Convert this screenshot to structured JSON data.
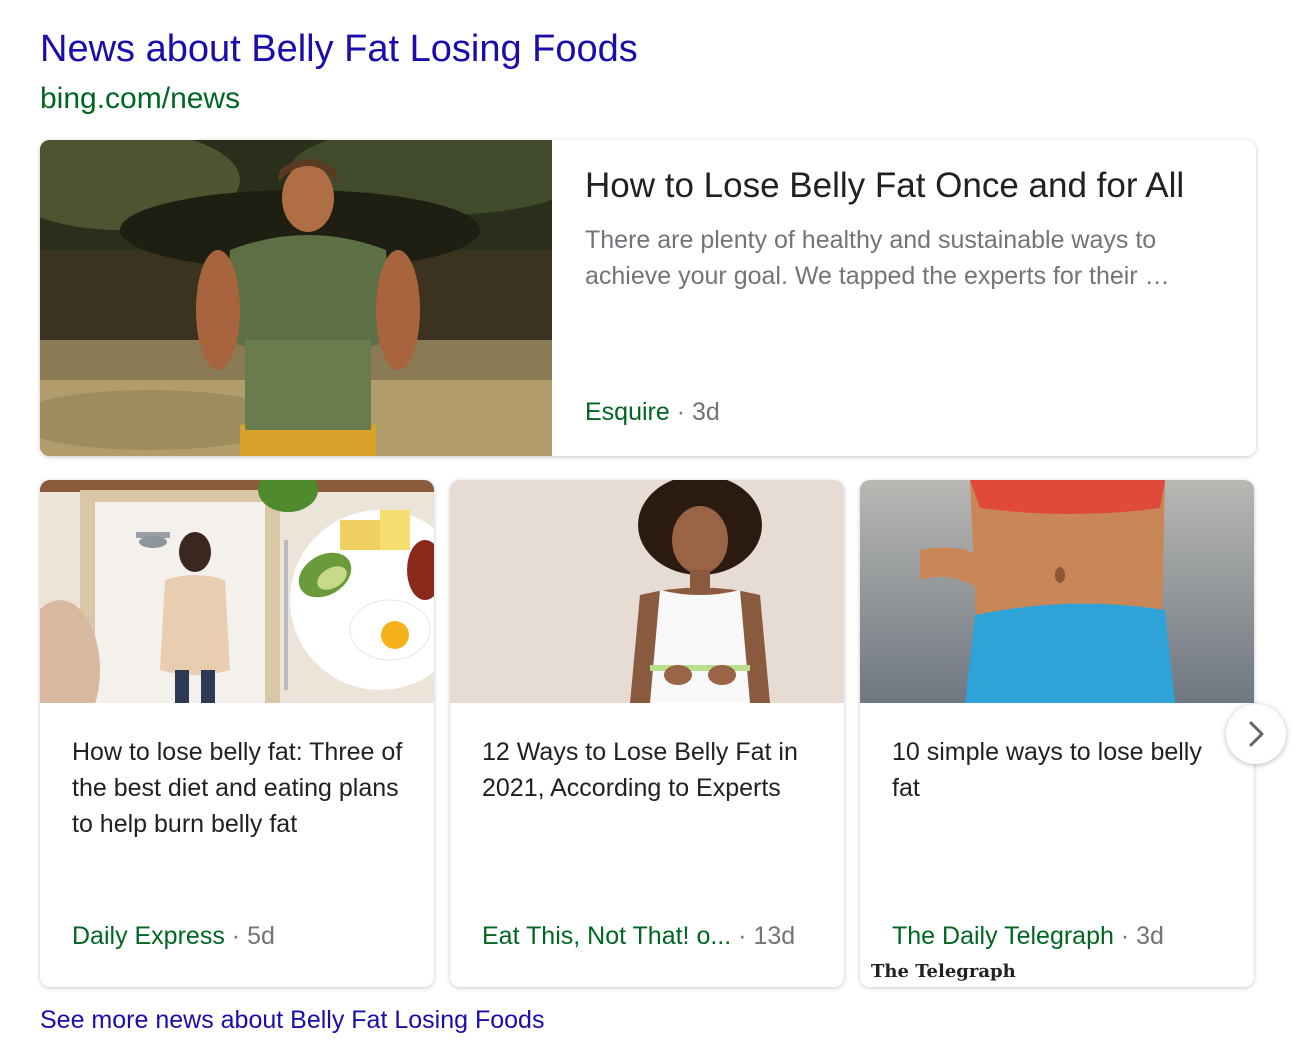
{
  "header": {
    "title": "News about Belly Fat Losing Foods",
    "source_url": "bing.com/news"
  },
  "featured": {
    "headline": "How to Lose Belly Fat Once and for All",
    "snippet": "There are plenty of healthy and sustainable ways to achieve your goal. We tapped the experts for their …",
    "source": "Esquire",
    "separator": "·",
    "age": "3d"
  },
  "cards": [
    {
      "headline": "How to lose belly fat: Three of the best diet and eating plans to help burn belly fat",
      "source": "Daily Express",
      "separator": "·",
      "age": "5d"
    },
    {
      "headline": "12 Ways to Lose Belly Fat in 2021, According to Experts",
      "source": "Eat This, Not That! o...",
      "separator": "·",
      "age": "13d"
    },
    {
      "headline": "10 simple ways to lose belly fat",
      "source": "The Daily Telegraph",
      "separator": "·",
      "age": "3d",
      "logo_text": "The Telegraph"
    }
  ],
  "see_more": "See more news about Belly Fat Losing Foods",
  "icons": {
    "next": "chevron-right-icon"
  },
  "colors": {
    "link": "#1a0dab",
    "source": "#006621",
    "muted": "#70757a",
    "headline": "#202124"
  }
}
